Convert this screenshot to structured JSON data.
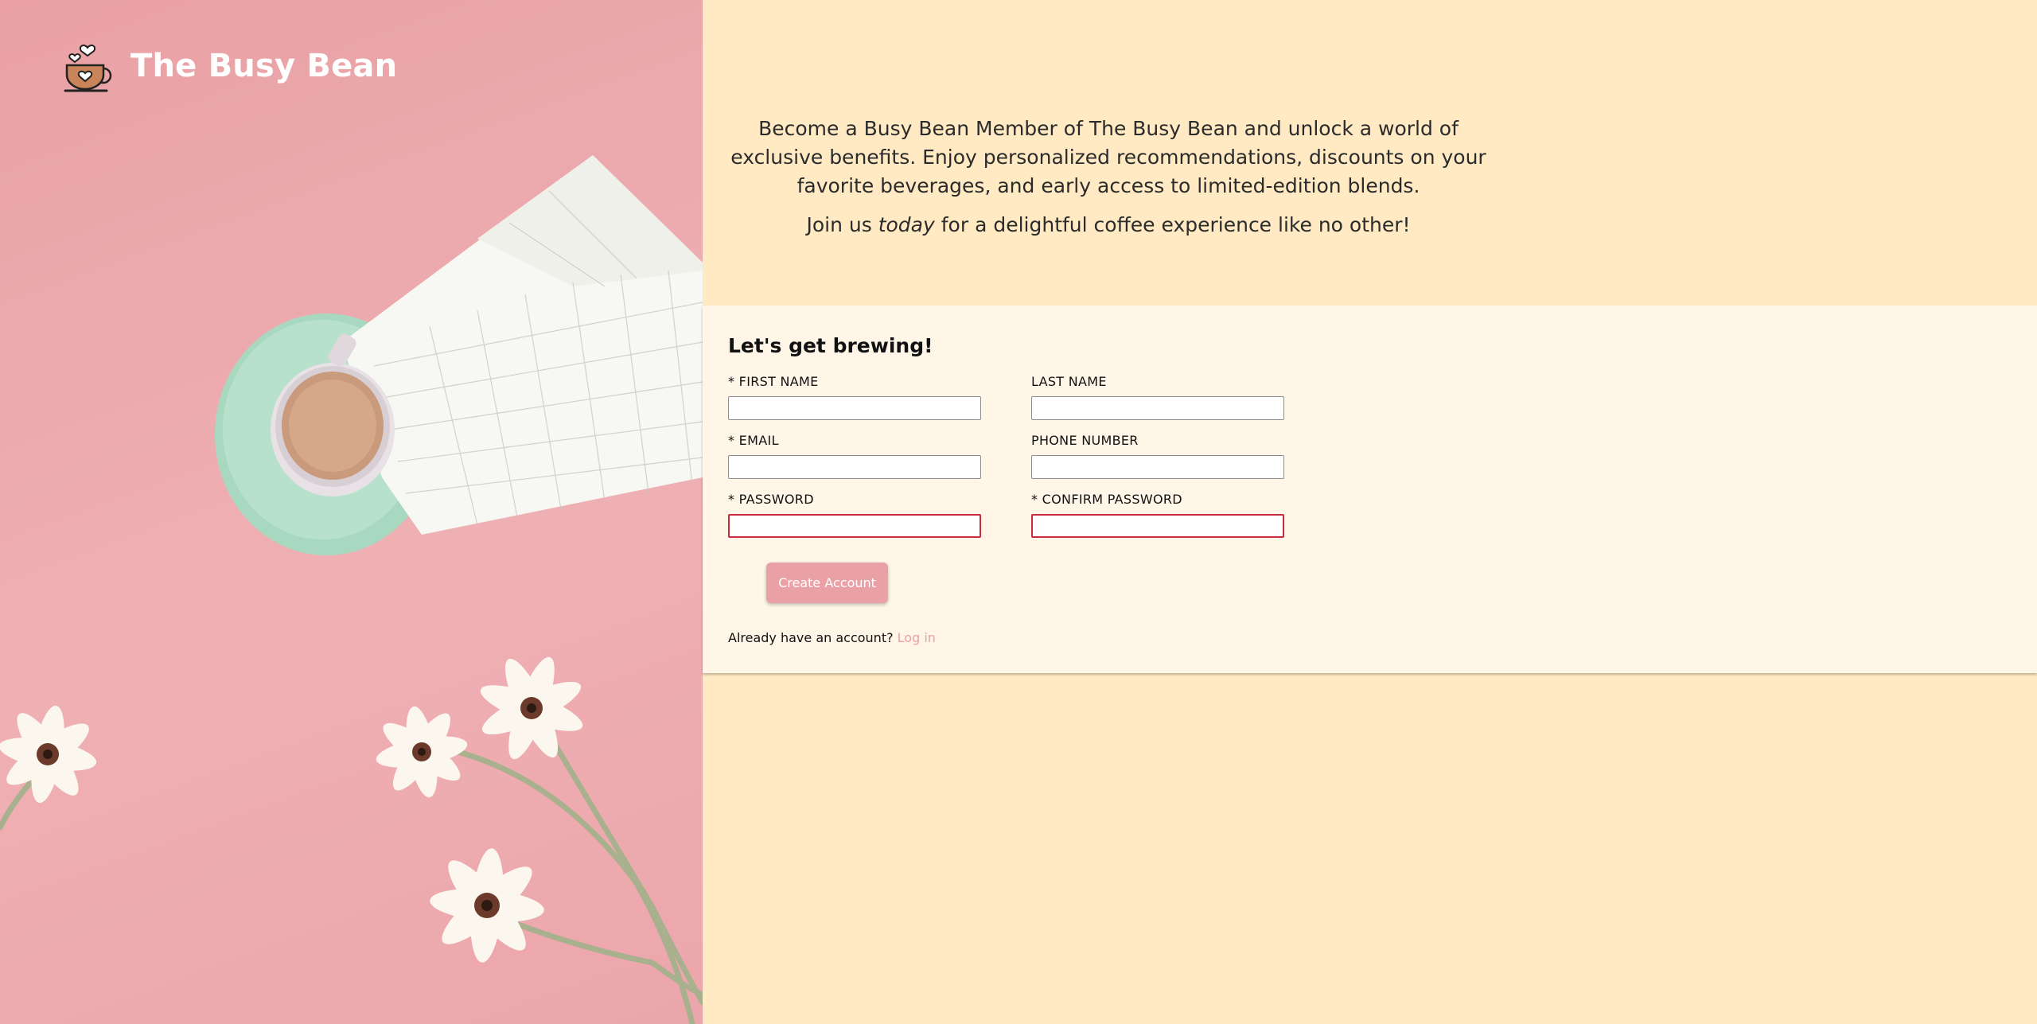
{
  "brand": {
    "name": "The Busy Bean",
    "logo_icon": "coffee-cup-hearts-icon",
    "text_color": "#ffffff"
  },
  "hero": {
    "background": "#e9a1a5",
    "image_description_icon": "coffee-and-flowers-photo"
  },
  "intro": {
    "blurb": "Become a Busy Bean Member of The Busy Bean and unlock a world of exclusive benefits. Enjoy personalized recommendations, discounts on your favorite beverages, and early access to limited-edition blends.",
    "join_prefix": "Join us ",
    "join_em": "today",
    "join_suffix": " for a delightful coffee experience like no other!"
  },
  "form": {
    "heading": "Let's get brewing!",
    "fields": {
      "first_name": {
        "label": "* FIRST NAME",
        "value": ""
      },
      "last_name": {
        "label": "LAST NAME",
        "value": ""
      },
      "email": {
        "label": "* EMAIL",
        "value": ""
      },
      "phone": {
        "label": "PHONE NUMBER",
        "value": ""
      },
      "password": {
        "label": "* PASSWORD",
        "value": ""
      },
      "confirm_password": {
        "label": "* CONFIRM PASSWORD",
        "value": ""
      }
    },
    "submit_label": "Create Account",
    "already_text": "Already have an account? ",
    "login_link": "Log in"
  },
  "colors": {
    "accent": "#e9a1a5",
    "page_background": "#ffeac4",
    "panel_background": "#fff6e8",
    "invalid_border": "#c92a3d"
  }
}
